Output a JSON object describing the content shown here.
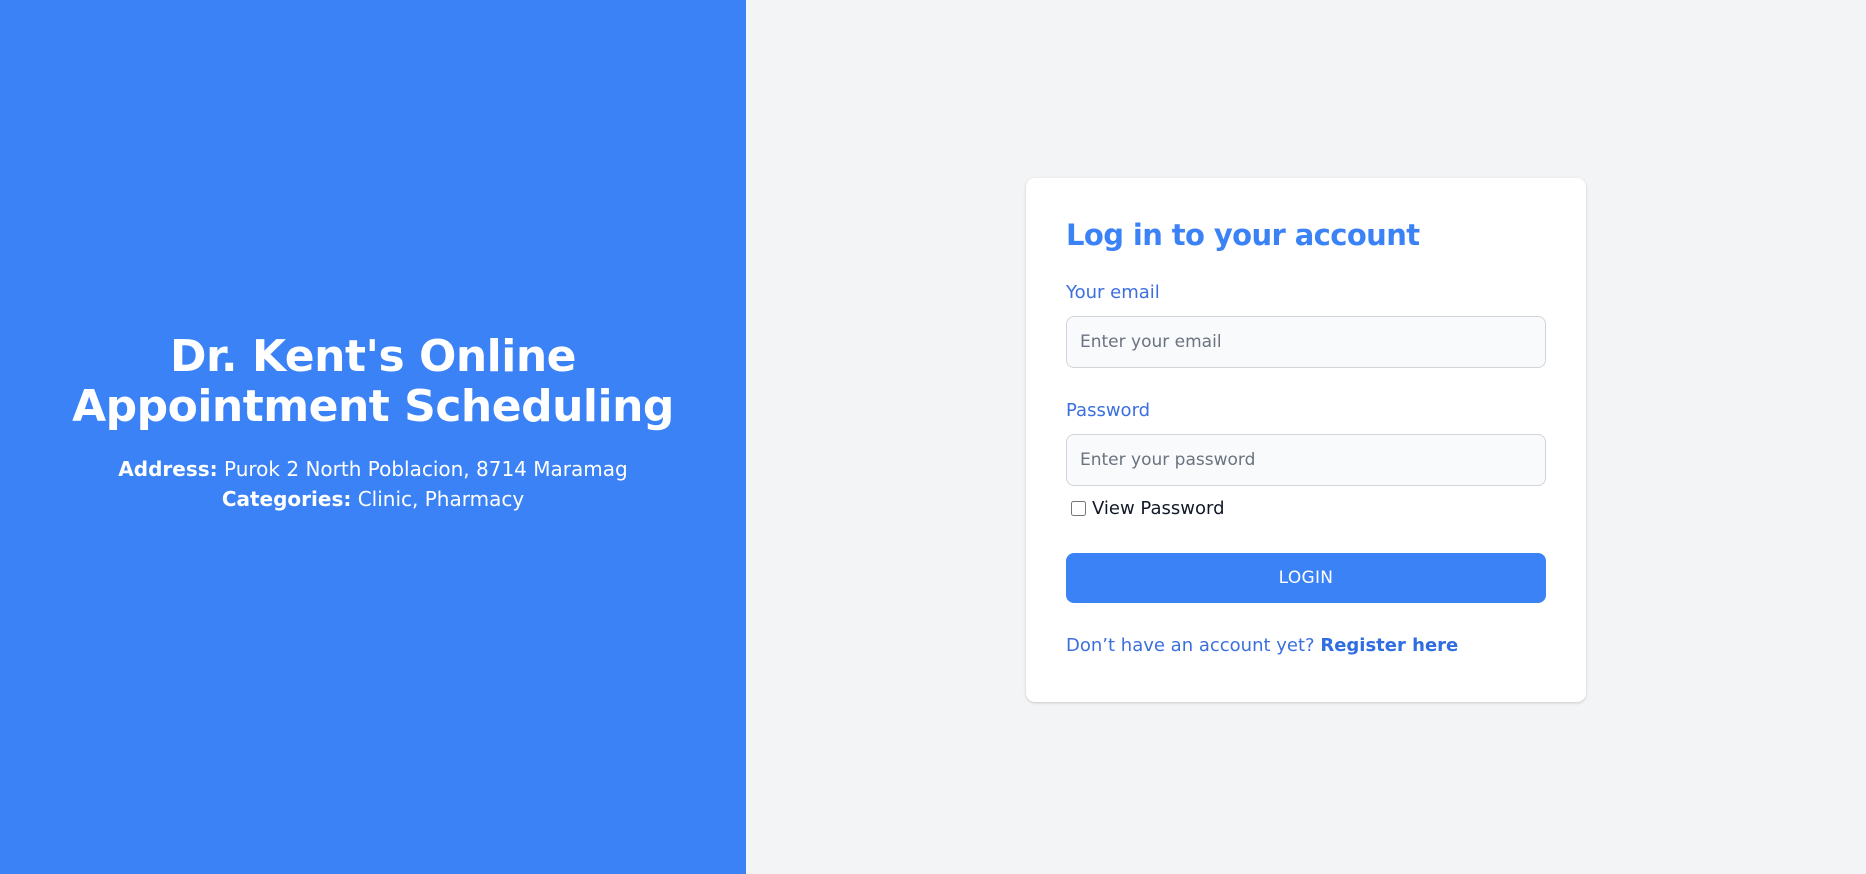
{
  "brand": {
    "title": "Dr. Kent's Online Appointment Scheduling",
    "address_label": "Address:",
    "address_value": "Purok 2 North Poblacion, 8714 Maramag",
    "categories_label": "Categories:",
    "categories_value": "Clinic, Pharmacy"
  },
  "login": {
    "title": "Log in to your account",
    "email_label": "Your email",
    "email_placeholder": "Enter your email",
    "email_value": "",
    "password_label": "Password",
    "password_placeholder": "Enter your password",
    "password_value": "",
    "view_password_label": "View Password",
    "view_password_checked": false,
    "submit_label": "LOGIN",
    "register_prompt": "Don’t have an account yet?",
    "register_link": "Register here"
  },
  "colors": {
    "primary": "#3b82f6",
    "page_background": "#f3f4f6",
    "card_background": "#ffffff"
  }
}
